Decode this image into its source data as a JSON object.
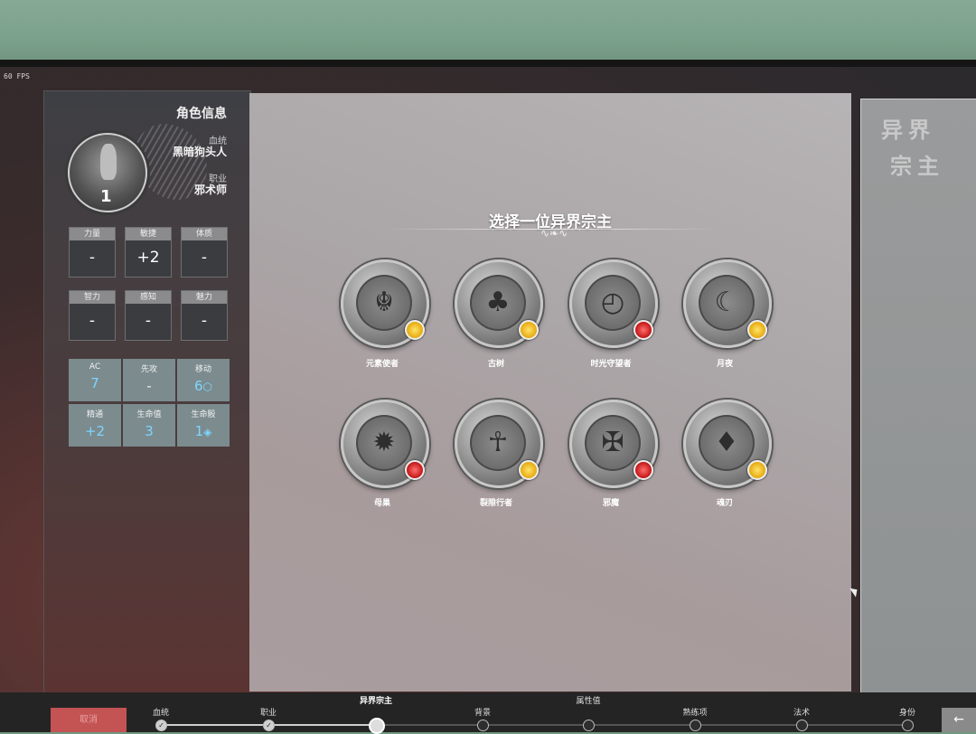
{
  "overlay": {
    "fps": "60 FPS"
  },
  "character": {
    "title": "角色信息",
    "level": "1",
    "lineage_label": "血统",
    "lineage_value": "黑暗狗头人",
    "class_label": "职业",
    "class_value": "邪术师"
  },
  "abilities": [
    {
      "label": "力量",
      "value": "-"
    },
    {
      "label": "敏捷",
      "value": "+2"
    },
    {
      "label": "体质",
      "value": "-"
    },
    {
      "label": "智力",
      "value": "-"
    },
    {
      "label": "感知",
      "value": "-"
    },
    {
      "label": "魅力",
      "value": "-"
    }
  ],
  "combat": [
    {
      "label": "AC",
      "value": "7"
    },
    {
      "label": "先攻",
      "value": "-"
    },
    {
      "label": "移动",
      "value": "6"
    },
    {
      "label": "精通",
      "value": "+2"
    },
    {
      "label": "生命值",
      "value": "3"
    },
    {
      "label": "生命骰",
      "value": "1"
    }
  ],
  "main": {
    "heading": "选择一位异界宗主",
    "patrons": [
      {
        "name": "元素使者",
        "icon": "elemental-face-icon",
        "badge": "gold"
      },
      {
        "name": "古树",
        "icon": "ancient-tree-icon",
        "badge": "gold"
      },
      {
        "name": "时光守望者",
        "icon": "time-watcher-icon",
        "badge": "red"
      },
      {
        "name": "月夜",
        "icon": "moon-tentacle-icon",
        "badge": "gold"
      },
      {
        "name": "母巢",
        "icon": "hive-mother-icon",
        "badge": "red"
      },
      {
        "name": "裂隙行者",
        "icon": "rift-walker-icon",
        "badge": "gold"
      },
      {
        "name": "邪魔",
        "icon": "fiend-icon",
        "badge": "red"
      },
      {
        "name": "魂刃",
        "icon": "soul-blade-icon",
        "badge": "gold"
      }
    ]
  },
  "right_panel": {
    "title_line1": "异界",
    "title_line2": "宗主"
  },
  "bottom": {
    "cancel": "取消",
    "steps": [
      {
        "label": "血统",
        "state": "done"
      },
      {
        "label": "职业",
        "state": "done"
      },
      {
        "label": "异界宗主",
        "state": "current"
      },
      {
        "label": "背景",
        "state": "todo"
      },
      {
        "label": "属性值",
        "state": "todo"
      },
      {
        "label": "熟练项",
        "state": "todo"
      },
      {
        "label": "法术",
        "state": "todo"
      },
      {
        "label": "身份",
        "state": "todo"
      }
    ],
    "back": "←"
  }
}
